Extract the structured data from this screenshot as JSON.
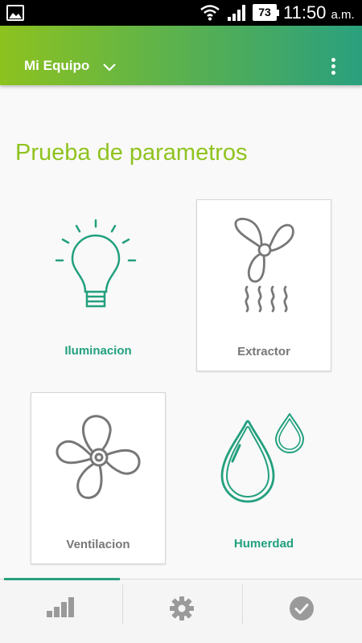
{
  "status_bar": {
    "battery": "73",
    "time": "11:50",
    "ampm": "a.m."
  },
  "app_bar": {
    "title": "Mi Equipo"
  },
  "page": {
    "heading": "Prueba de parametros"
  },
  "tiles": [
    {
      "label": "Iluminacion",
      "icon": "lightbulb-icon",
      "selected": false
    },
    {
      "label": "Extractor",
      "icon": "extractor-fan-icon",
      "selected": true
    },
    {
      "label": "Ventilacion",
      "icon": "fan-icon",
      "selected": true
    },
    {
      "label": "Humerdad",
      "icon": "humidity-drops-icon",
      "selected": false
    }
  ],
  "bottom_nav": {
    "tabs": [
      {
        "icon": "signal-bars-icon",
        "active": true
      },
      {
        "icon": "gear-icon",
        "active": false
      },
      {
        "icon": "check-circle-icon",
        "active": false
      }
    ]
  },
  "colors": {
    "accent_green": "#8fc31f",
    "accent_teal": "#22a07e",
    "icon_gray": "#777777"
  }
}
